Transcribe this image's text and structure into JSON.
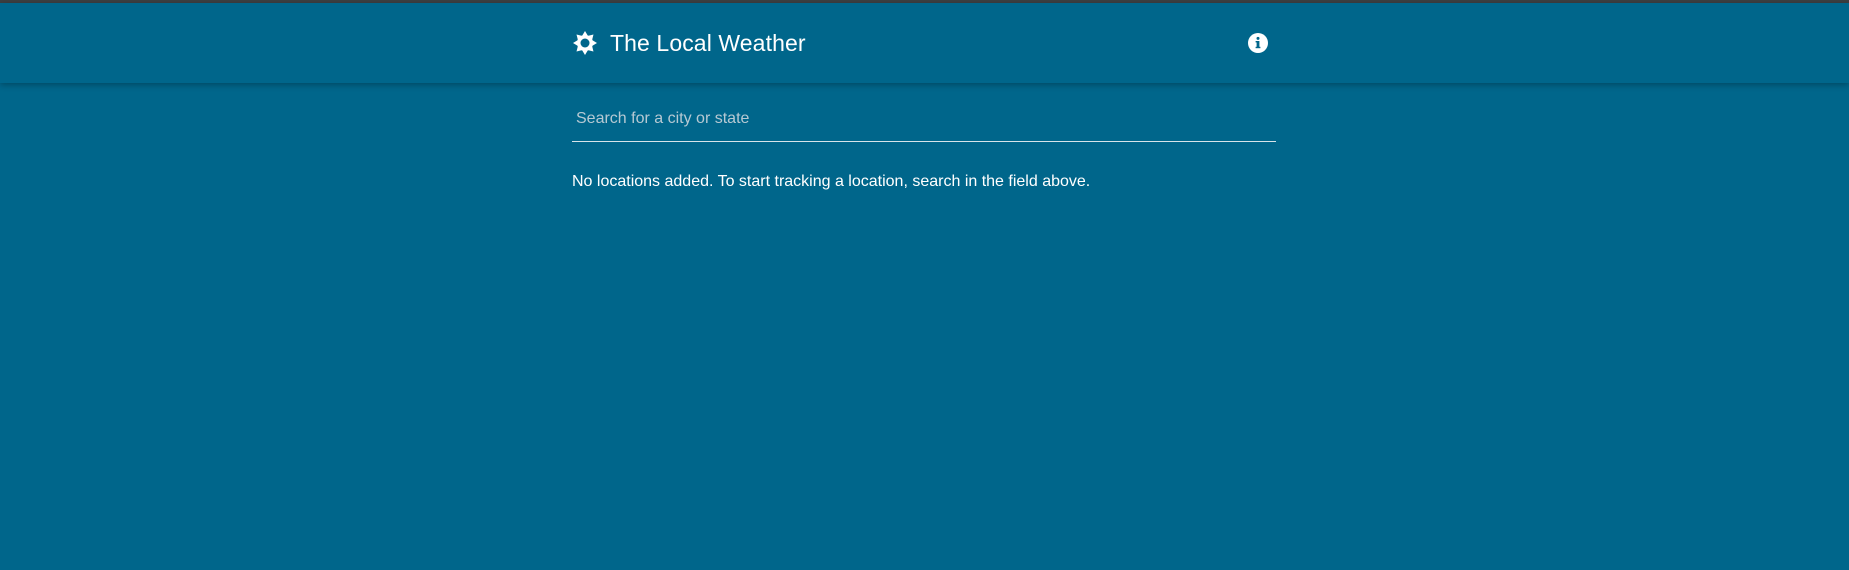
{
  "colors": {
    "background": "#00668b",
    "text": "#ffffff",
    "placeholder": "#b6c9d3",
    "underline": "#d7e4ea"
  },
  "header": {
    "logo_icon": "sun-icon",
    "title": "The Local Weather",
    "info_icon": "info-icon"
  },
  "search": {
    "value": "",
    "placeholder": "Search for a city or state"
  },
  "main": {
    "empty_message": "No locations added. To start tracking a location, search in the field above."
  }
}
